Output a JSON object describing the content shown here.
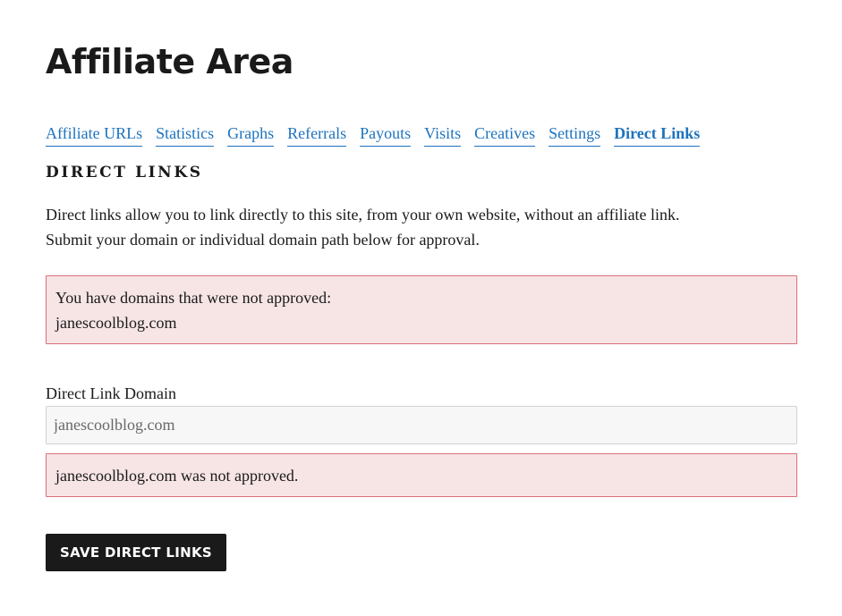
{
  "page": {
    "title": "Affiliate Area"
  },
  "tabs": [
    {
      "label": "Affiliate URLs",
      "active": false
    },
    {
      "label": "Statistics",
      "active": false
    },
    {
      "label": "Graphs",
      "active": false
    },
    {
      "label": "Referrals",
      "active": false
    },
    {
      "label": "Payouts",
      "active": false
    },
    {
      "label": "Visits",
      "active": false
    },
    {
      "label": "Creatives",
      "active": false
    },
    {
      "label": "Settings",
      "active": false
    },
    {
      "label": "Direct Links",
      "active": true
    }
  ],
  "section": {
    "title": "DIRECT LINKS",
    "intro_lines": [
      "Direct links allow you to link directly to this site, from your own website, without an affiliate link.",
      "Submit your domain or individual domain path below for approval."
    ]
  },
  "notice": {
    "line1": "You have domains that were not approved:",
    "line2": "janescoolblog.com"
  },
  "form": {
    "label": "Direct Link Domain",
    "value": "janescoolblog.com",
    "error": "janescoolblog.com was not approved.",
    "submit_label": "SAVE DIRECT LINKS"
  },
  "colors": {
    "link": "#1e73be",
    "error_bg": "#f7e5e6",
    "error_border": "#d7707a",
    "button_bg": "#1a1a1a"
  }
}
